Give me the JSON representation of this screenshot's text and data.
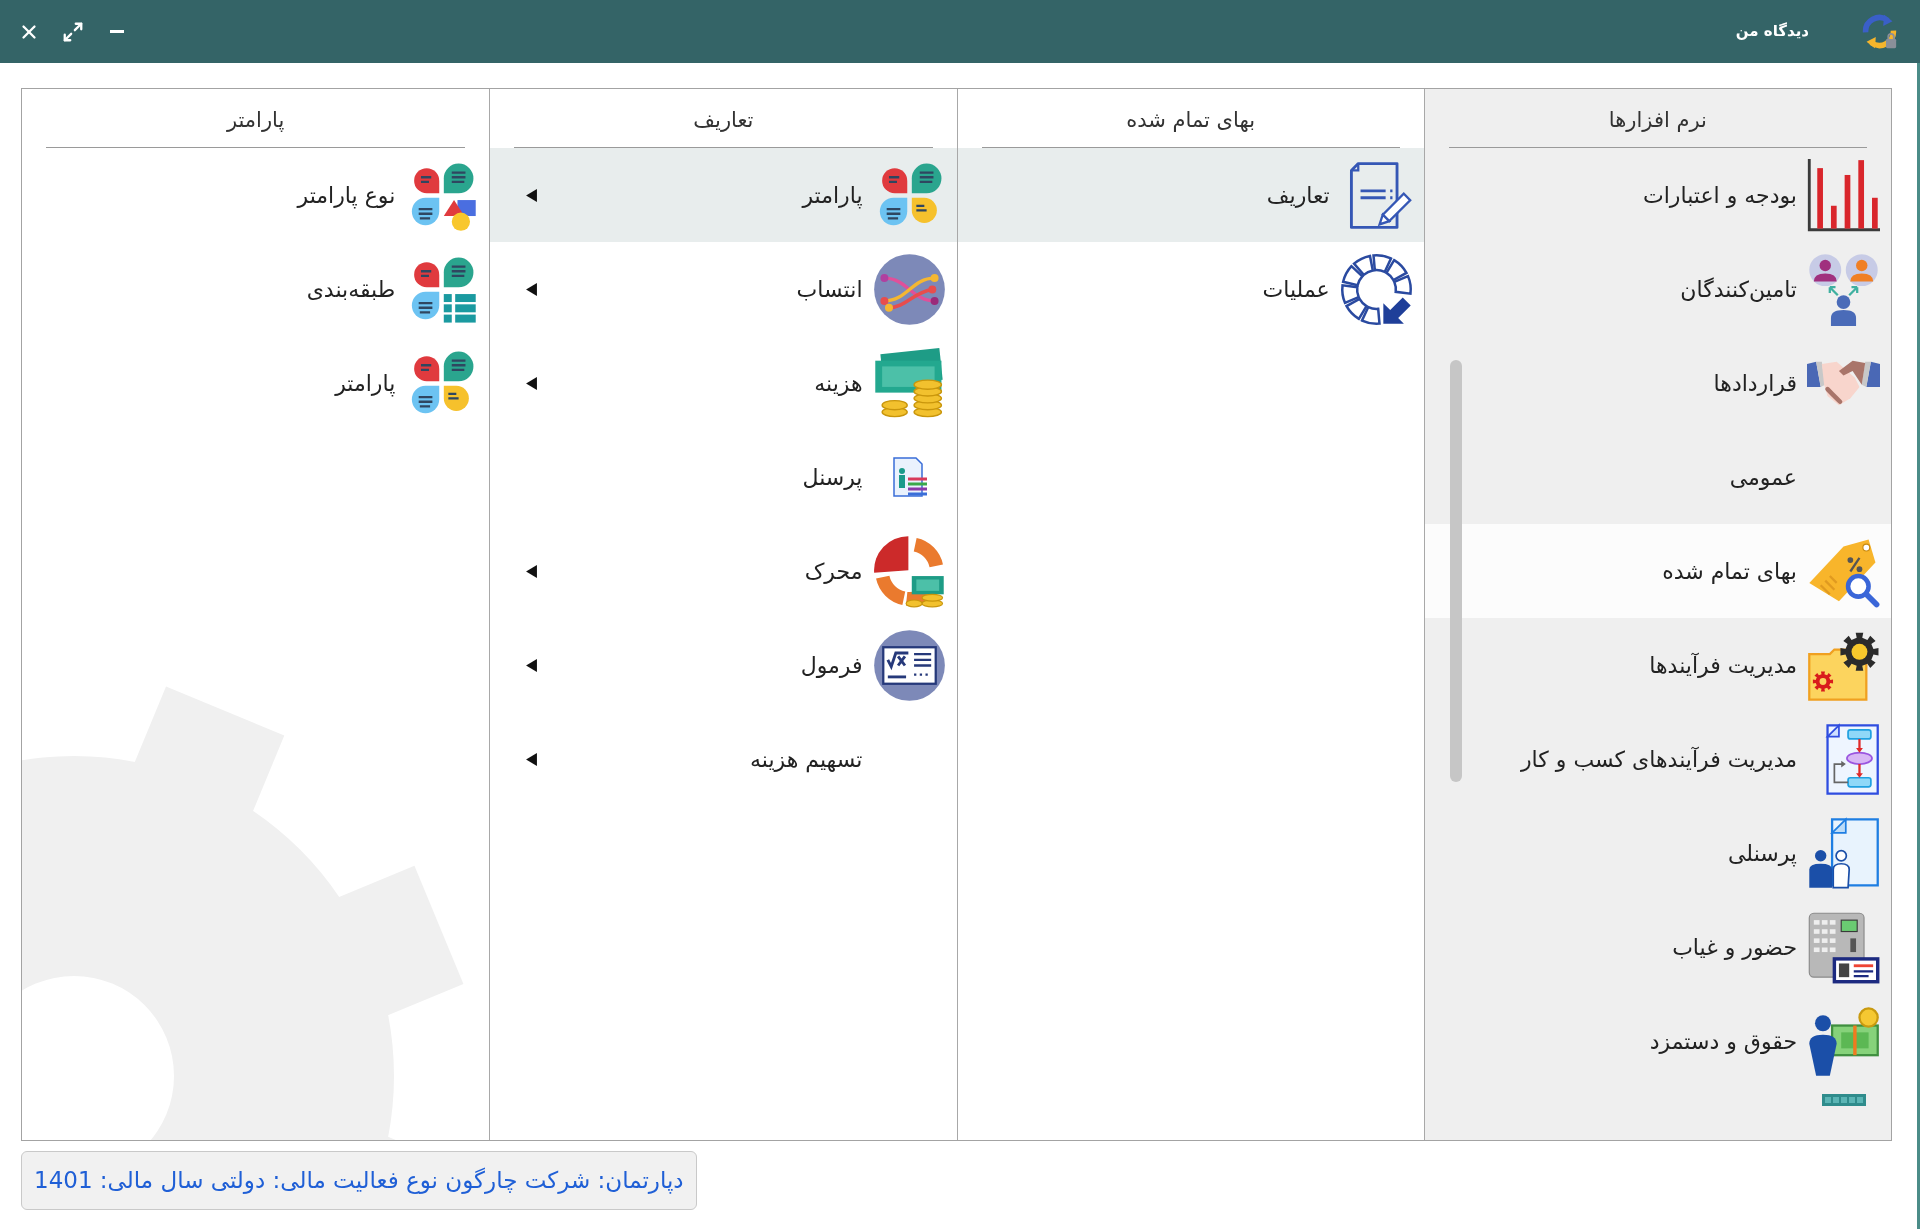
{
  "window": {
    "title": "دیدگاه من"
  },
  "columns": [
    {
      "heading": "نرم افزارها",
      "items": [
        {
          "label": "بودجه و اعتبارات",
          "selected": false
        },
        {
          "label": "تامین‌کنندگان",
          "selected": false
        },
        {
          "label": "قراردادها",
          "selected": false
        },
        {
          "label": "عمومی",
          "selected": false
        },
        {
          "label": "بهای تمام شده",
          "selected": true
        },
        {
          "label": "مدیریت فرآیندها",
          "selected": false
        },
        {
          "label": "مدیریت فرآیندهای کسب و کار",
          "selected": false
        },
        {
          "label": "پرسنلی",
          "selected": false
        },
        {
          "label": "حضور و غیاب",
          "selected": false
        },
        {
          "label": "حقوق و دستمزد",
          "selected": false
        }
      ]
    },
    {
      "heading": "بهای تمام شده",
      "items": [
        {
          "label": "تعاریف",
          "selected": true
        },
        {
          "label": "عملیات",
          "selected": false
        }
      ]
    },
    {
      "heading": "تعاریف",
      "items": [
        {
          "label": "پارامتر",
          "selected": true,
          "submenu": true
        },
        {
          "label": "انتساب",
          "selected": false,
          "submenu": true
        },
        {
          "label": "هزینه",
          "selected": false,
          "submenu": true
        },
        {
          "label": "پرسنل",
          "selected": false,
          "submenu": false
        },
        {
          "label": "محرک",
          "selected": false,
          "submenu": true
        },
        {
          "label": "فرمول",
          "selected": false,
          "submenu": true
        },
        {
          "label": "تسهیم هزینه",
          "selected": false,
          "submenu": true
        }
      ]
    },
    {
      "heading": "پارامتر",
      "items": [
        {
          "label": "نوع پارامتر",
          "selected": false
        },
        {
          "label": "طبقه‌بندی",
          "selected": false
        },
        {
          "label": "پارامتر",
          "selected": false
        }
      ]
    }
  ],
  "status_bar": {
    "text": "دپارتمان: شرکت چارگون نوع فعالیت مالی: دولتی سال مالی: 1401"
  }
}
